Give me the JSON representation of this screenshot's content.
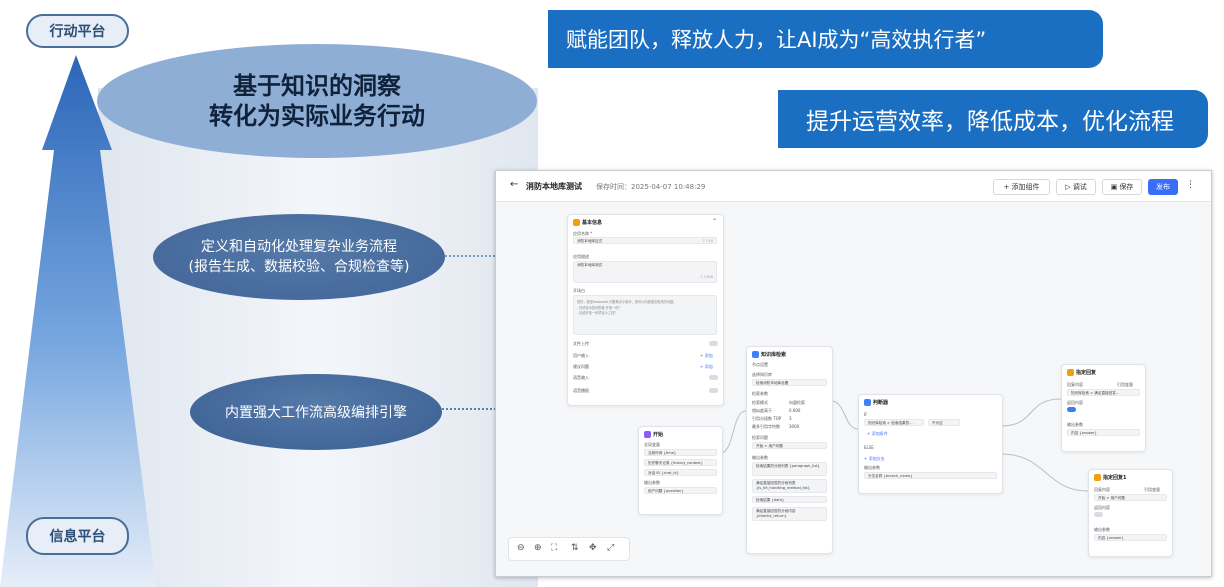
{
  "left": {
    "top_label": "行动平台",
    "bottom_label": "信息平台",
    "top_oval_line1": "基于知识的洞察",
    "top_oval_line2": "转化为实际业务行动",
    "oval1_line1": "定义和自动化处理复杂业务流程",
    "oval1_line2": "(报告生成、数据校验、合规检查等)",
    "oval2": "内置强大工作流高级编排引擎"
  },
  "banners": [
    "赋能团队，释放人力，让AI成为“高效执行者”",
    "提升运营效率，降低成本，优化流程"
  ],
  "colors": {
    "accent": "#1a6fc2",
    "publish": "#3b6ef6",
    "oval_dark": "#3f6496"
  },
  "app": {
    "back_icon": "arrow-left-icon",
    "title": "消防本地库测试",
    "save_time": "保存时间：2025-04-07 10:48:29",
    "add_component": "+ 添加组件",
    "debug": "▷ 调试",
    "save": "保存",
    "publish": "发布",
    "basic_node": {
      "title": "基本信息",
      "name_label": "应用名称 *",
      "name_value": "消防本地库应试",
      "name_count": "7 / 50",
      "desc_label": "应用描述",
      "desc_value": "消防本地库测试",
      "desc_count": "7 / 500",
      "opening_label": "开场白",
      "opening_text": "您好，我是deepseek 问数助手小助手，您可以向我提出相关的问题。",
      "opening_hint1": "- 在项目中如何配置 开放一份？",
      "opening_hint2": "- 请给开放一份项目小工具？",
      "file_upload": "文件上传",
      "user_input": "用户输入",
      "suggest": "建议问题",
      "voice_input": "语音输入",
      "voice_play": "语音播报",
      "add": "+ 添加"
    },
    "start_node": {
      "title": "开始",
      "global_vars": "全局变量",
      "vars": [
        "当前时间 {time}",
        "历史聊天记录 {history_context}",
        "对话 ID {chat_id}"
      ],
      "output_label": "输出参数",
      "output_value": "用户问题 {question}"
    },
    "kb_node": {
      "title": "知识库检索",
      "section": "节点设置",
      "kb_label": "选择知识库",
      "kb_item": "检索消防本地库设置",
      "params_label": "检索参数",
      "rows": [
        [
          "检索模式",
          "向量检索"
        ],
        [
          "相似度高于",
          "0.600"
        ],
        [
          "引用分段数 TOP",
          "3"
        ],
        [
          "最多引用字符数",
          "3000"
        ]
      ],
      "question_label": "检索问题",
      "question_value": "开始 > 用户问题",
      "output_label": "输出参数",
      "outputs": [
        "检索结果的分段列表 {paragraph_list}",
        "满足直接回答的分段列表 {is_hit_handling_method_list}",
        "检索结果 {data}",
        "满足直接回答的分段内容 {directly_return}"
      ]
    },
    "judge_node": {
      "title": "判断器",
      "if_label": "IF",
      "cond_a": "知识库检索 > 检索结果的...",
      "cond_op": "不为空",
      "add_cond": "+ 添加条件",
      "else_label": "ELSE",
      "add_branch": "+ 添加分支",
      "output_label": "输出参数",
      "output_value": "分支名称 {branch_name}"
    },
    "reply_node1": {
      "title": "指定回复",
      "content_label": "回复内容",
      "content_select": "引用变量",
      "content_value": "知识库检索 > 满足直接回答...",
      "return_label": "返回内容",
      "output_label": "输出参数",
      "output_value": "内容 {answer}"
    },
    "reply_node2": {
      "title": "指定回复1",
      "content_label": "回复内容",
      "content_select": "引用变量",
      "content_value": "开始 > 用户问题",
      "return_label": "返回内容",
      "output_label": "输出参数",
      "output_value": "内容 {answer}"
    }
  }
}
